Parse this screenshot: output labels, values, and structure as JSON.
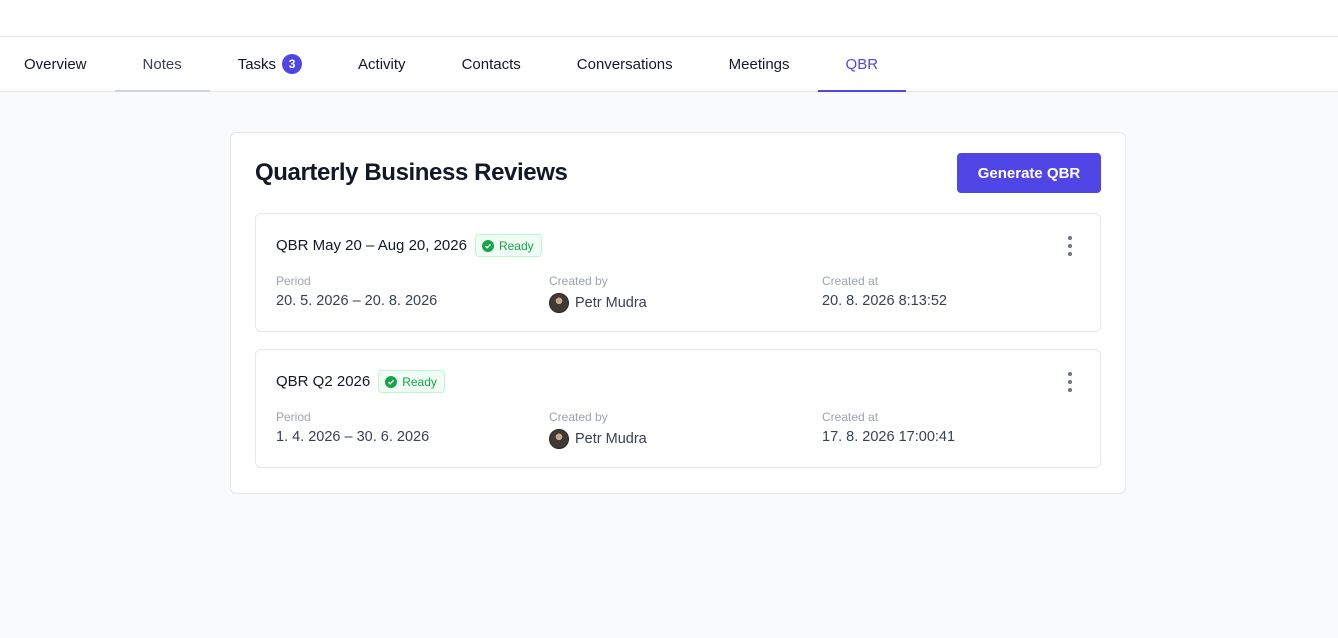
{
  "tabs": [
    {
      "label": "Overview"
    },
    {
      "label": "Notes"
    },
    {
      "label": "Tasks",
      "count": "3"
    },
    {
      "label": "Activity"
    },
    {
      "label": "Contacts"
    },
    {
      "label": "Conversations"
    },
    {
      "label": "Meetings"
    },
    {
      "label": "QBR",
      "active": true
    }
  ],
  "panel": {
    "title": "Quarterly Business Reviews",
    "generate_label": "Generate QBR"
  },
  "colors": {
    "accent": "#4f46e5",
    "ready": "#16a34a"
  },
  "reviews": [
    {
      "title": "QBR May 20 – Aug 20, 2026",
      "status": "Ready",
      "period_label": "Period",
      "period": "20. 5. 2026 – 20. 8. 2026",
      "created_by_label": "Created by",
      "created_by": "Petr Mudra",
      "created_at_label": "Created at",
      "created_at": "20. 8. 2026 8:13:52"
    },
    {
      "title": "QBR Q2 2026",
      "status": "Ready",
      "period_label": "Period",
      "period": "1. 4. 2026 – 30. 6. 2026",
      "created_by_label": "Created by",
      "created_by": "Petr Mudra",
      "created_at_label": "Created at",
      "created_at": "17. 8. 2026 17:00:41"
    }
  ]
}
